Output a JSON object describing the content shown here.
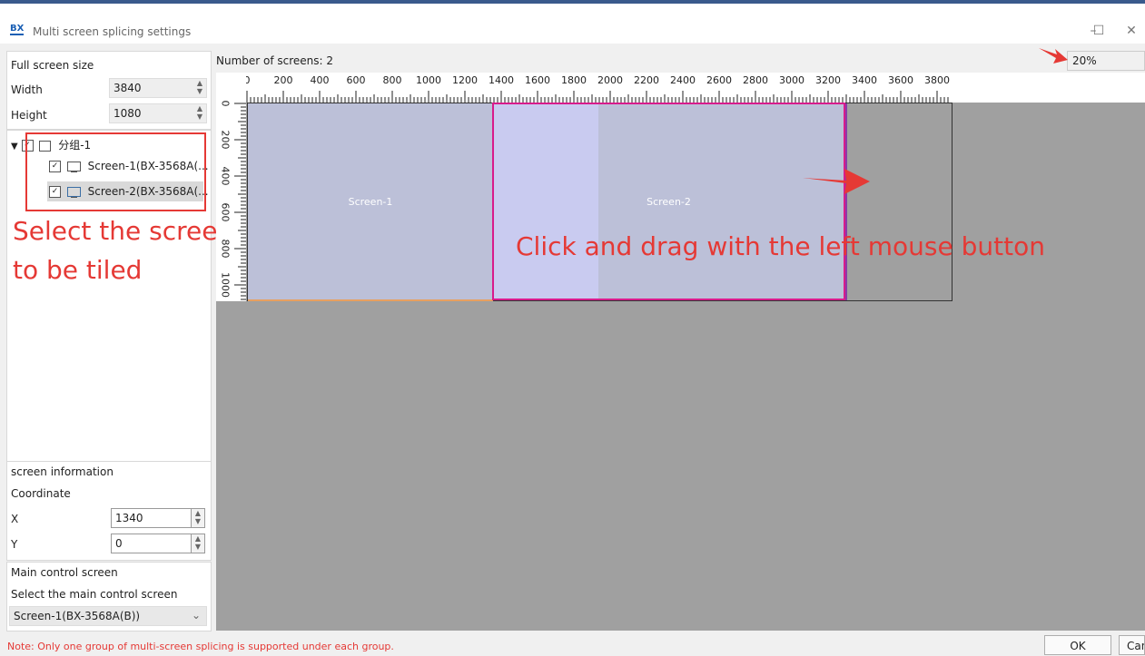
{
  "window": {
    "title": "Multi screen splicing settings",
    "app_icon": "BX",
    "minimize": "–",
    "maximize": "☐",
    "close": "✕"
  },
  "left": {
    "full_screen_size_label": "Full screen size",
    "width_label": "Width",
    "width_value": "3840",
    "height_label": "Height",
    "height_value": "1080",
    "tree": {
      "group_label": "分组-1",
      "items": [
        {
          "label": "Screen-1(BX-3568A(..."
        },
        {
          "label": "Screen-2(BX-3568A(..."
        }
      ]
    },
    "screen_info_label": "screen information",
    "coordinate_label": "Coordinate",
    "x_label": "X",
    "x_value": "1340",
    "y_label": "Y",
    "y_value": "0",
    "main_control_label": "Main control screen",
    "select_main_label": "Select the main control screen",
    "main_select_value": "Screen-1(BX-3568A(B))"
  },
  "canvas": {
    "screen_count_label": "Number of screens: 2",
    "zoom": "20%",
    "ruler_top_labels": [
      "0",
      "200",
      "400",
      "600",
      "800",
      "1000",
      "1200",
      "1400",
      "1600",
      "1800",
      "2000",
      "2200",
      "2400",
      "2600",
      "2800",
      "3000",
      "3200",
      "3400",
      "3600",
      "3800"
    ],
    "ruler_left_labels": [
      "0",
      "200",
      "400",
      "600",
      "800",
      "1000"
    ],
    "screens": [
      {
        "label": "Screen-1"
      },
      {
        "label": "Screen-2"
      }
    ]
  },
  "annotations": {
    "select_text_1": "Select the screens",
    "select_text_2": "to be tiled",
    "drag_text": "Click and drag with the left mouse button",
    "color": "#e53935"
  },
  "footer": {
    "note": "Note: Only one group of multi-screen splicing is supported under each group.",
    "ok": "OK",
    "cancel": "Cancel"
  }
}
